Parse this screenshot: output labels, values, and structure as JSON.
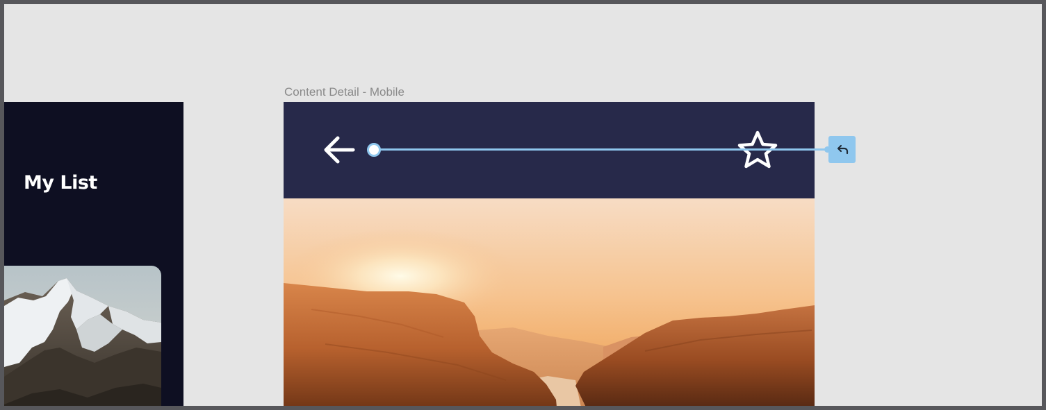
{
  "left_frame": {
    "title": "My List",
    "card_image": "snowy-mountain-photo"
  },
  "main_frame": {
    "label": "Content Detail - Mobile",
    "header": {
      "back_icon": "arrow-left-icon",
      "favorite_icon": "star-outline-icon",
      "background": "#27294a"
    },
    "hero_image": "sunset-fjord-photo"
  },
  "prototype_connection": {
    "action_icon": "back-arrow-icon",
    "color": "#8fc7ee"
  },
  "colors": {
    "canvas": "#e5e5e5",
    "left_frame_bg": "#0e0f22",
    "header_bg": "#27294a",
    "connection": "#8fc7ee"
  }
}
